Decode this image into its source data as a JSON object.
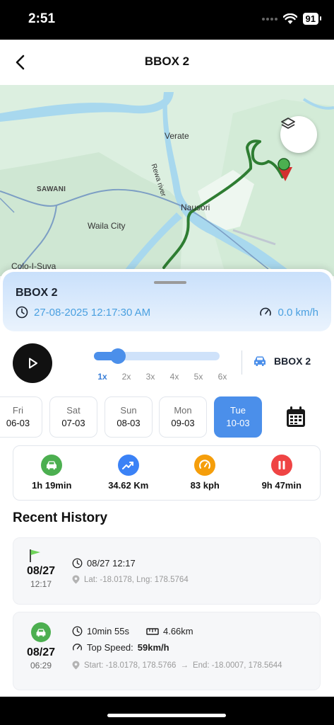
{
  "status_bar": {
    "time": "2:51",
    "battery": "91"
  },
  "header": {
    "title": "BBOX 2"
  },
  "map": {
    "labels": [
      "Verate",
      "Rewa river",
      "SAWANI",
      "Nausori",
      "Waila City",
      "Colo-I-Suva"
    ],
    "layers_icon": "layers-icon"
  },
  "vehicle_info": {
    "name": "BBOX 2",
    "datetime": "27-08-2025 12:17:30 AM",
    "speed": "0.0 km/h"
  },
  "playback": {
    "speeds": [
      "1x",
      "2x",
      "3x",
      "4x",
      "5x",
      "6x"
    ],
    "selected_speed": "1x",
    "progress": 0.19,
    "vehicle_label": "BBOX 2"
  },
  "dates": [
    {
      "dow": "Fri",
      "date": "06-03"
    },
    {
      "dow": "Sat",
      "date": "07-03"
    },
    {
      "dow": "Sun",
      "date": "08-03"
    },
    {
      "dow": "Mon",
      "date": "09-03"
    },
    {
      "dow": "Tue",
      "date": "10-03",
      "selected": true
    }
  ],
  "stats": [
    {
      "value": "1h 19min",
      "icon": "car-icon",
      "color": "#4caf50"
    },
    {
      "value": "34.62 Km",
      "icon": "trending-up-icon",
      "color": "#3b82f6"
    },
    {
      "value": "83 kph",
      "icon": "speedometer-icon",
      "color": "#f59e0b"
    },
    {
      "value": "9h 47min",
      "icon": "pause-icon",
      "color": "#ef4444"
    }
  ],
  "recent_history": {
    "title": "Recent History",
    "items": [
      {
        "type": "start",
        "date": "08/27",
        "time": "12:17",
        "timestamp": "08/27 12:17",
        "location": "Lat: -18.0178, Lng: 178.5764"
      },
      {
        "type": "trip",
        "date": "08/27",
        "time": "06:29",
        "duration": "10min 55s",
        "distance": "4.66km",
        "top_speed_label": "Top Speed:",
        "top_speed_value": "59km/h",
        "route_start": "Start: -18.0178, 178.5766",
        "route_arrow": "→",
        "route_end": "End: -18.0007, 178.5644"
      }
    ]
  },
  "colors": {
    "accent": "#4b8fea",
    "route": "#2e7d32"
  }
}
